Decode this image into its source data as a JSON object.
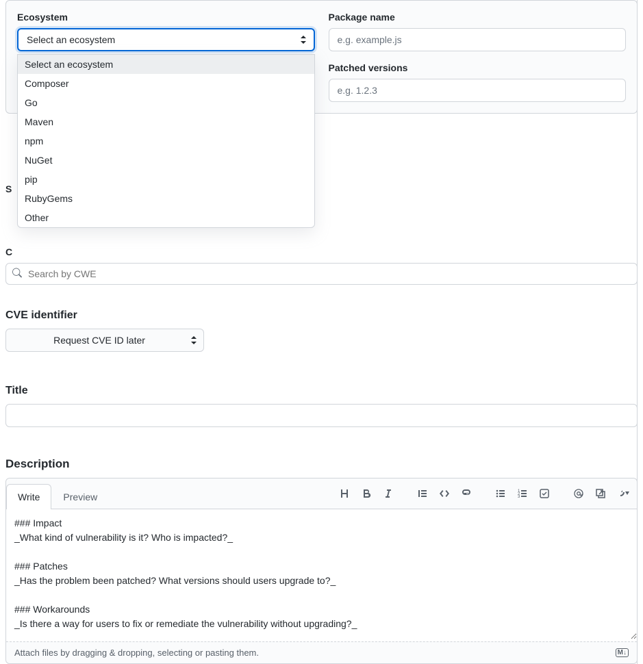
{
  "affected": {
    "ecosystem_label": "Ecosystem",
    "ecosystem_selected": "Select an ecosystem",
    "ecosystem_options": [
      "Select an ecosystem",
      "Composer",
      "Go",
      "Maven",
      "npm",
      "NuGet",
      "pip",
      "RubyGems",
      "Other"
    ],
    "package_label": "Package name",
    "package_placeholder": "e.g. example.js",
    "patched_label": "Patched versions",
    "patched_placeholder": "e.g. 1.2.3"
  },
  "obscured": {
    "s_label": "S",
    "c_label": "C"
  },
  "cwe": {
    "placeholder": "Search by CWE"
  },
  "cve": {
    "label": "CVE identifier",
    "selected": "Request CVE ID later"
  },
  "title": {
    "label": "Title"
  },
  "description": {
    "label": "Description",
    "tabs": {
      "write": "Write",
      "preview": "Preview"
    },
    "content": "### Impact\n_What kind of vulnerability is it? Who is impacted?_\n\n### Patches\n_Has the problem been patched? What versions should users upgrade to?_\n\n### Workarounds\n_Is there a way for users to fix or remediate the vulnerability without upgrading?_",
    "attach_hint": "Attach files by dragging & dropping, selecting or pasting them.",
    "md_badge": "M↓"
  }
}
